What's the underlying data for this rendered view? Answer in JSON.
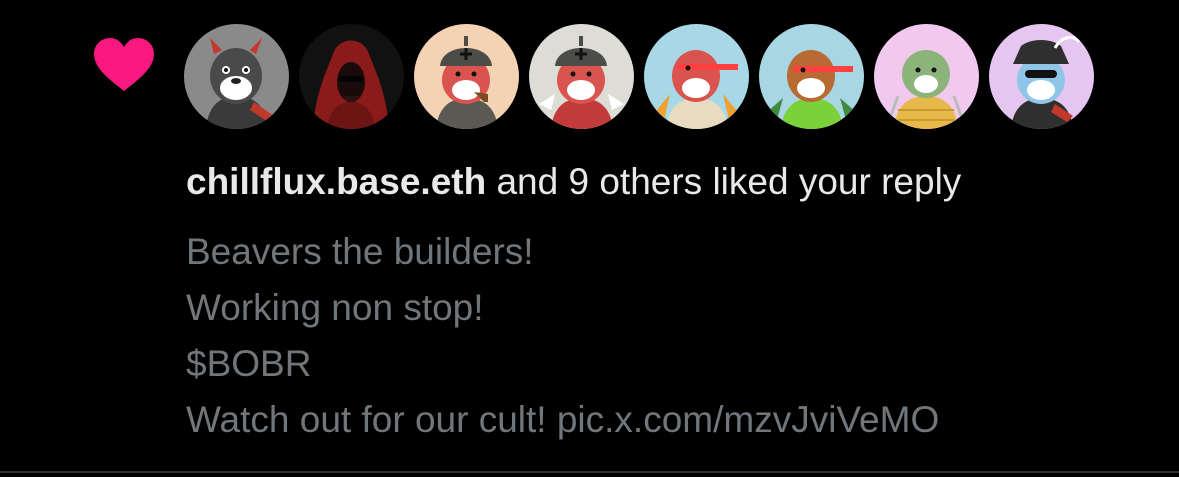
{
  "colors": {
    "background": "#000000",
    "heart": "#f91880",
    "primary_text": "#e7e9ea",
    "secondary_text": "#71767b",
    "divider": "#2f3336"
  },
  "notification": {
    "type_icon": "heart-icon",
    "avatars": [
      {
        "icon": "beaver-avatar",
        "bg": "#8a8a8a"
      },
      {
        "icon": "hooded-figure-avatar",
        "bg": "#111111"
      },
      {
        "icon": "beaver-avatar",
        "bg": "#f4d2b4"
      },
      {
        "icon": "beaver-avatar",
        "bg": "#ddddd6"
      },
      {
        "icon": "beaver-avatar",
        "bg": "#a8d8e6"
      },
      {
        "icon": "beaver-avatar",
        "bg": "#a9d6e3"
      },
      {
        "icon": "beaver-avatar",
        "bg": "#f2c9ee"
      },
      {
        "icon": "beaver-avatar",
        "bg": "#e4c6f1"
      }
    ],
    "username": "chillflux.base.eth",
    "action_text": " and 9 others liked your reply",
    "reply_lines": [
      "Beavers the builders!",
      "Working non stop!",
      "$BOBR",
      "Watch out for our cult! "
    ],
    "link_text": "pic.x.com/mzvJviVeMO"
  }
}
